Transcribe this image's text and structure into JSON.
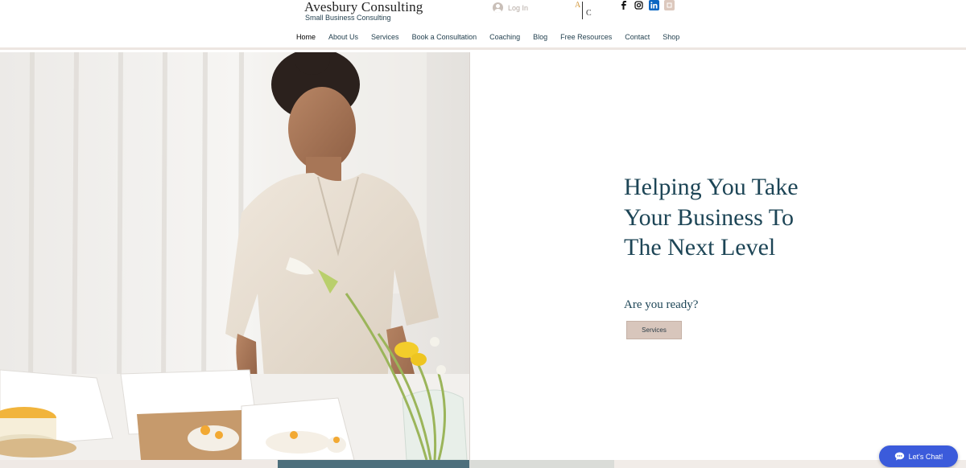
{
  "header": {
    "brand_title": "Avesbury Consulting",
    "brand_subtitle": "Small Business Consulting",
    "login_label": "Log In",
    "logo": {
      "letter_a": "A",
      "letter_c": "C"
    },
    "socials": [
      "facebook-icon",
      "instagram-icon",
      "linkedin-icon",
      "extra-social-icon"
    ]
  },
  "nav": {
    "items": [
      {
        "label": "Home"
      },
      {
        "label": "About Us"
      },
      {
        "label": "Services"
      },
      {
        "label": "Book a Consultation"
      },
      {
        "label": "Coaching"
      },
      {
        "label": "Blog"
      },
      {
        "label": "Free Resources"
      },
      {
        "label": "Contact"
      },
      {
        "label": "Shop"
      }
    ],
    "active_index": 0
  },
  "hero": {
    "headline": "Helping You Take Your Business To The Next Level",
    "subline": "Are you ready?",
    "cta_label": "Services"
  },
  "chat": {
    "label": "Let's Chat!"
  },
  "colors": {
    "primary_text": "#1d4556",
    "accent": "#d8c6bc",
    "chat_button": "#3b5bdb"
  }
}
